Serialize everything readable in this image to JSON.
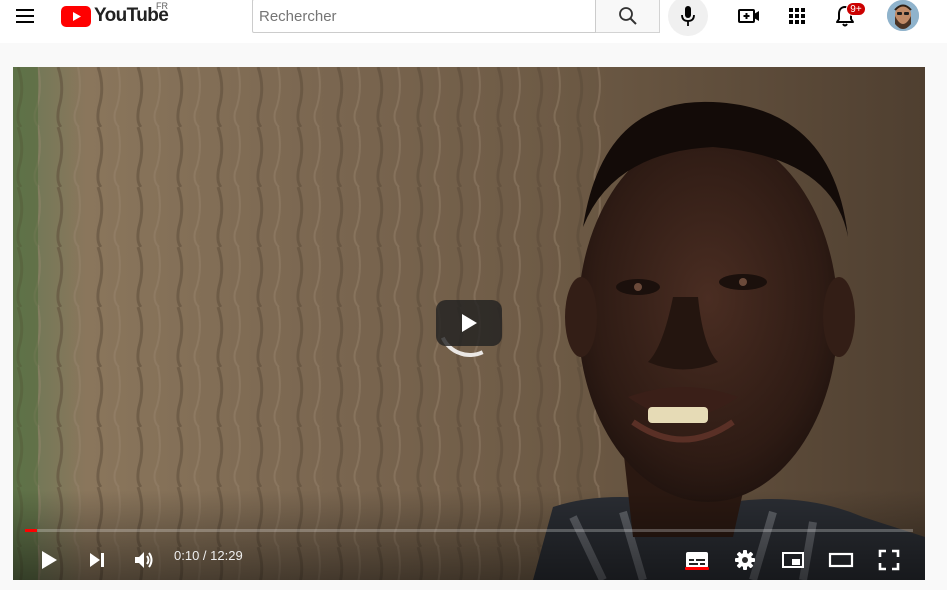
{
  "header": {
    "logo_text": "YouTube",
    "country_code": "FR",
    "search": {
      "placeholder": "Rechercher",
      "value": ""
    },
    "notifications_count": "9+",
    "icons": [
      "menu-icon",
      "youtube-logo",
      "search-icon",
      "mic-icon",
      "create-video-icon",
      "apps-grid-icon",
      "bell-icon"
    ]
  },
  "player": {
    "current_time": "0:10",
    "duration": "12:29",
    "time_display": "0:10 / 12:29",
    "progress_fraction": 0.013,
    "subtitles_on": true,
    "controls": [
      "play-icon",
      "next-icon",
      "volume-icon",
      "subtitles-icon",
      "settings-icon",
      "miniplayer-icon",
      "theater-icon",
      "fullscreen-icon"
    ]
  },
  "colors": {
    "brand_red": "#ff0000",
    "badge_red": "#cc0000",
    "header_bg": "#ffffff",
    "page_bg": "#f9f9f9"
  }
}
